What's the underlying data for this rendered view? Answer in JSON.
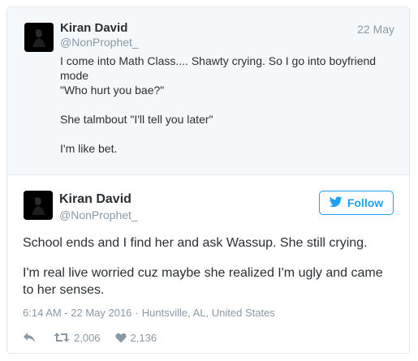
{
  "quoted_tweet": {
    "author_name": "Kiran David",
    "handle": "@NonProphet_",
    "date": "22 May",
    "lines": [
      "I come into Math Class.... Shawty crying. So I go into boyfriend mode",
      "\"Who hurt you bae?\"",
      "She talmbout \"I'll tell you later\"",
      "I'm like bet."
    ]
  },
  "main_tweet": {
    "author_name": "Kiran David",
    "handle": "@NonProphet_",
    "follow_label": "Follow",
    "paragraphs": [
      "School ends and I find her and ask Wassup. She still crying.",
      "I'm real live worried cuz maybe she realized I'm ugly and came to her senses."
    ],
    "timestamp": "6:14 AM - 22 May 2016",
    "separator": "·",
    "location": "Huntsville, AL, United States",
    "retweet_count": "2,006",
    "like_count": "2,136"
  },
  "colors": {
    "accent": "#1da1f2",
    "muted": "#8899a6",
    "text": "#292f33",
    "quoted_bg": "#f5f8fa"
  },
  "icons": {
    "follow": "twitter-bird-icon",
    "reply": "reply-arrow-icon",
    "retweet": "retweet-icon",
    "like": "heart-icon"
  }
}
